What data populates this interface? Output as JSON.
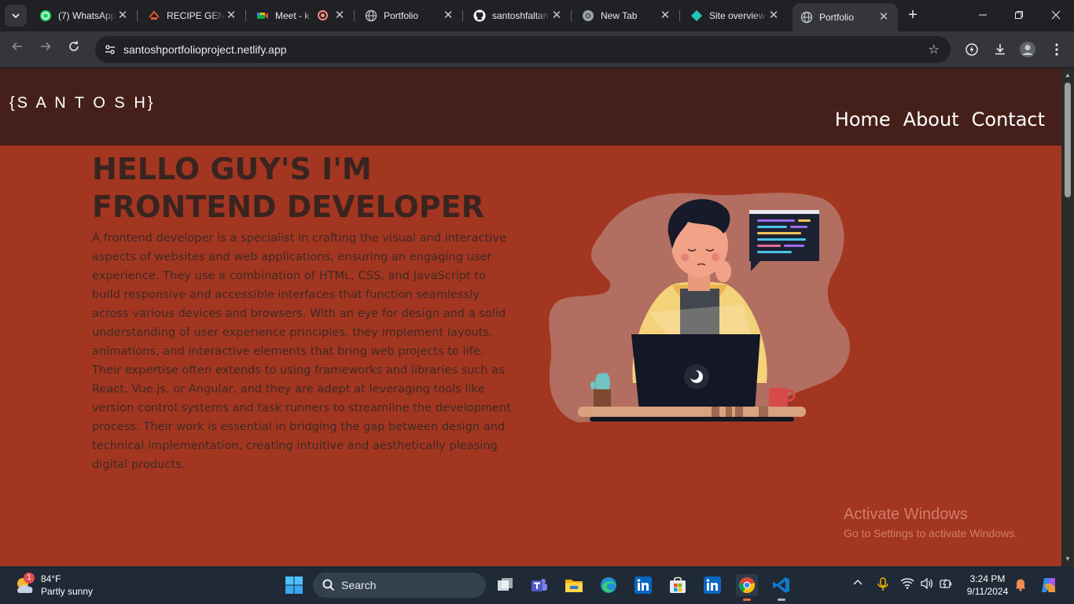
{
  "browser": {
    "tabs": [
      {
        "title": "(7) WhatsApp",
        "icon": "whatsapp-icon"
      },
      {
        "title": "RECIPE GENE",
        "icon": "recipe-icon"
      },
      {
        "title": "Meet - k",
        "icon": "meet-icon"
      },
      {
        "title": "Portfolio",
        "icon": "globe-icon"
      },
      {
        "title": "santoshfaltan",
        "icon": "github-icon"
      },
      {
        "title": "New Tab",
        "icon": "chrome-icon"
      },
      {
        "title": "Site overview",
        "icon": "netlify-icon"
      },
      {
        "title": "Portfolio",
        "icon": "globe-icon",
        "active": true
      }
    ],
    "url": "santoshportfolioproject.netlify.app"
  },
  "site": {
    "logo": "{S A N T O S H}",
    "nav": [
      "Home",
      "About",
      "Contact"
    ],
    "hero_title_line1": "HELLO GUY'S I'M",
    "hero_title_line2": "FRONTEND DEVELOPER",
    "hero_paragraph": "A frontend developer is a specialist in crafting the visual and interactive aspects of websites and web applications, ensuring an engaging user experience. They use a combination of HTML, CSS, and JavaScript to build responsive and accessible interfaces that function seamlessly across various devices and browsers. With an eye for design and a solid understanding of user experience principles, they implement layouts, animations, and interactive elements that bring web projects to life. Their expertise often extends to using frameworks and libraries such as React, Vue.js, or Angular, and they are adept at leveraging tools like version control systems and task runners to streamline the development process. Their work is essential in bridging the gap between design and technical implementation, creating intuitive and aesthetically pleasing digital products.",
    "illustration": "developer-at-laptop-illustration"
  },
  "watermark": {
    "line1": "Activate Windows",
    "line2": "Go to Settings to activate Windows."
  },
  "taskbar": {
    "weather_temp": "84°F",
    "weather_desc": "Partly sunny",
    "weather_badge": "1",
    "search_label": "Search",
    "time": "3:24 PM",
    "date": "9/11/2024"
  },
  "colors": {
    "page_bg": "#a33620",
    "header_bg": "#45201b",
    "title_text": "#3a2420"
  }
}
